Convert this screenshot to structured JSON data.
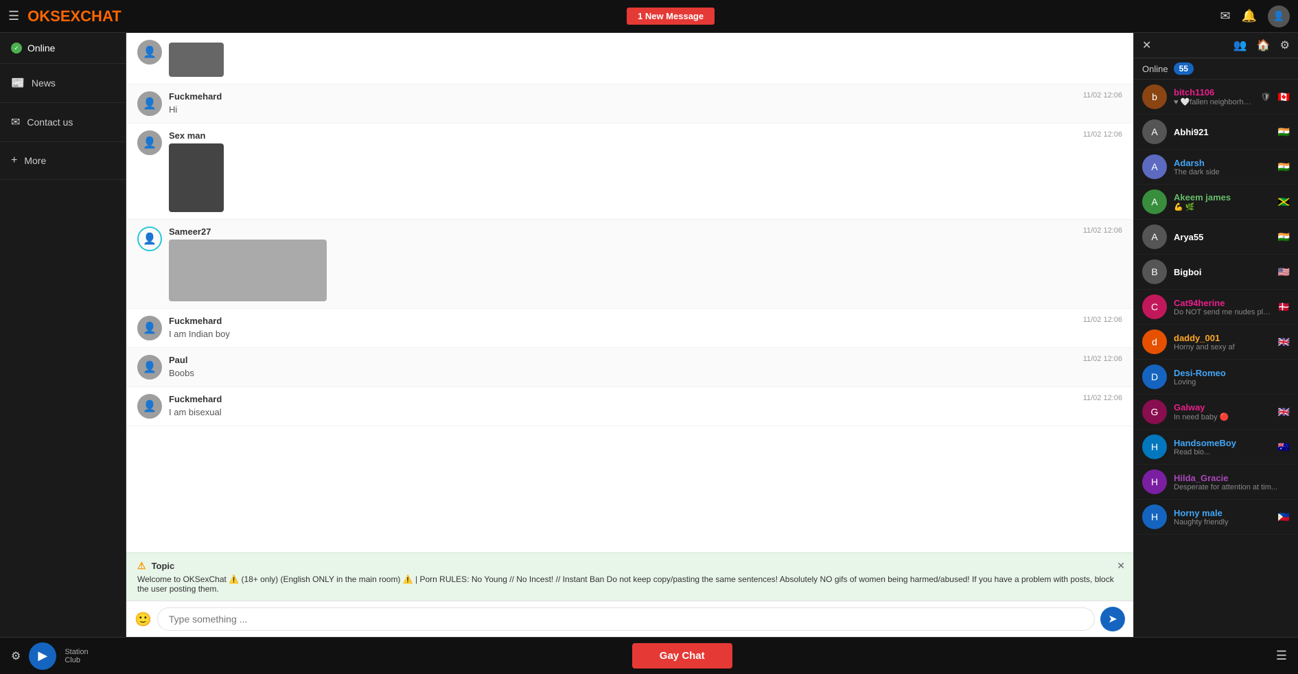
{
  "header": {
    "logo": "OKSEXCHAT",
    "logo_ok": "OK",
    "logo_sex": "SEX",
    "logo_chat": "CHAT",
    "new_message_label": "1 New Message",
    "hamburger_icon": "☰",
    "mail_icon": "✉",
    "bell_icon": "🔔",
    "user_icon": "👤"
  },
  "sidebar": {
    "online_label": "Online",
    "news_label": "News",
    "news_icon": "📰",
    "contact_label": "Contact us",
    "contact_icon": "✉",
    "more_label": "More",
    "more_icon": "+"
  },
  "chat": {
    "messages": [
      {
        "id": 1,
        "username": "",
        "has_image": true,
        "image_type": "top_crop",
        "time": "",
        "text": ""
      },
      {
        "id": 2,
        "username": "Fuckmehard",
        "text": "Hi",
        "time": "11/02 12:06",
        "has_image": false
      },
      {
        "id": 3,
        "username": "Sex man",
        "text": "",
        "time": "11/02 12:06",
        "has_image": true,
        "image_type": "explicit"
      },
      {
        "id": 4,
        "username": "Sameer27",
        "text": "",
        "time": "11/02 12:06",
        "has_image": true,
        "image_type": "wide"
      },
      {
        "id": 5,
        "username": "Fuckmehard",
        "text": "I am Indian boy",
        "time": "11/02 12:06",
        "has_image": false
      },
      {
        "id": 6,
        "username": "Paul",
        "text": "Boobs",
        "time": "11/02 12:06",
        "has_image": false
      },
      {
        "id": 7,
        "username": "Fuckmehard",
        "text": "I am bisexual",
        "time": "11/02 12:06",
        "has_image": false
      }
    ],
    "topic": {
      "title": "Topic",
      "text": "Welcome to OKSexChat ⚠️ (18+ only) (English ONLY in the main room) ⚠️ | Porn RULES: No Young // No Incest! // Instant Ban Do not keep copy/pasting the same sentences! Absolutely NO gifs of women being harmed/abused! If you have a problem with posts, block the user posting them."
    },
    "input_placeholder": "Type something ..."
  },
  "right_sidebar": {
    "online_label": "Online",
    "online_count": "55",
    "users": [
      {
        "name": "bitch1106",
        "status": "♥ 🤍fallen neighborhood...",
        "color": "pink",
        "flag": "🇨🇦",
        "has_shield": true,
        "avatar_color": "#8b4513"
      },
      {
        "name": "Abhi921",
        "status": "",
        "color": "white",
        "flag": "🇮🇳",
        "avatar_color": "#555"
      },
      {
        "name": "Adarsh",
        "status": "The dark side",
        "color": "blue",
        "flag": "🇮🇳",
        "avatar_color": "#5c6bc0"
      },
      {
        "name": "Akeem james",
        "status": "💪 🌿",
        "color": "green",
        "flag": "🇯🇲",
        "avatar_color": "#388e3c"
      },
      {
        "name": "Arya55",
        "status": "",
        "color": "white",
        "flag": "🇮🇳",
        "avatar_color": "#555"
      },
      {
        "name": "Bigboi",
        "status": "",
        "color": "white",
        "flag": "🇺🇸",
        "avatar_color": "#555"
      },
      {
        "name": "Cat94herine",
        "status": "Do NOT send me nudes please!",
        "color": "pink",
        "flag": "🇩🇰",
        "avatar_color": "#c2185b"
      },
      {
        "name": "daddy_001",
        "status": "Horny and sexy af",
        "color": "orange",
        "flag": "🇬🇧",
        "avatar_color": "#e65100"
      },
      {
        "name": "Desi-Romeo",
        "status": "Loving",
        "color": "blue",
        "flag": "",
        "avatar_color": "#1565c0"
      },
      {
        "name": "Galway",
        "status": "In need baby 🔴",
        "color": "pink",
        "flag": "🇬🇧",
        "avatar_color": "#880e4f"
      },
      {
        "name": "HandsomeBoy",
        "status": "Read bio...",
        "color": "blue",
        "flag": "🇦🇺",
        "avatar_color": "#0277bd"
      },
      {
        "name": "Hilda_Gracie",
        "status": "Desperate for attention at tim...",
        "color": "purple",
        "flag": "",
        "avatar_color": "#7b1fa2"
      },
      {
        "name": "Horny male",
        "status": "Naughty friendly",
        "color": "blue",
        "flag": "🇵🇭",
        "avatar_color": "#1565c0"
      }
    ]
  },
  "bottom_bar": {
    "settings_icon": "⚙",
    "play_icon": "▶",
    "station_label_top": "Station",
    "station_label_bottom": "Club",
    "gay_chat_label": "Gay Chat",
    "menu_icon": "☰"
  }
}
